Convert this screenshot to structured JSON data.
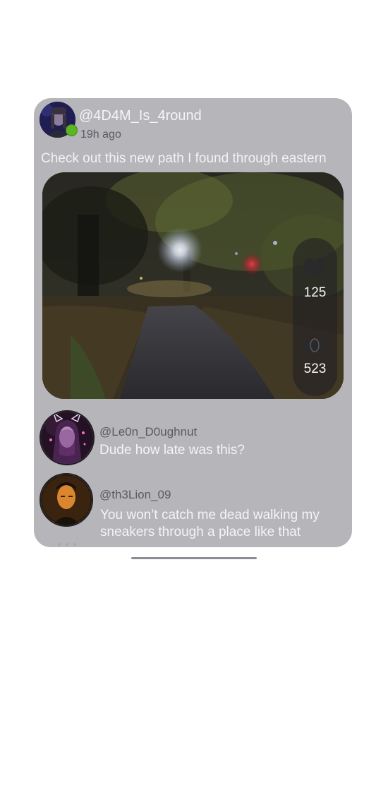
{
  "post": {
    "author": "@4D4M_Is_4round",
    "time": "19h ago",
    "caption": "Check out this new path I found through eastern",
    "online": true,
    "likes": "125",
    "views": "523"
  },
  "comments": [
    {
      "user": "@Le0n_D0ughnut",
      "text": "Dude how late was this?"
    },
    {
      "user": "@th3Lion_09",
      "text": "You won’t catch me dead walking my sneakers through a place like that"
    }
  ],
  "icons": {
    "like": "heart-icon",
    "views": "eye-icon",
    "online": "online-status-dot"
  },
  "colors": {
    "card_background": "#b6b5ba",
    "online": "#5db524",
    "stats_pill": "#222124"
  }
}
